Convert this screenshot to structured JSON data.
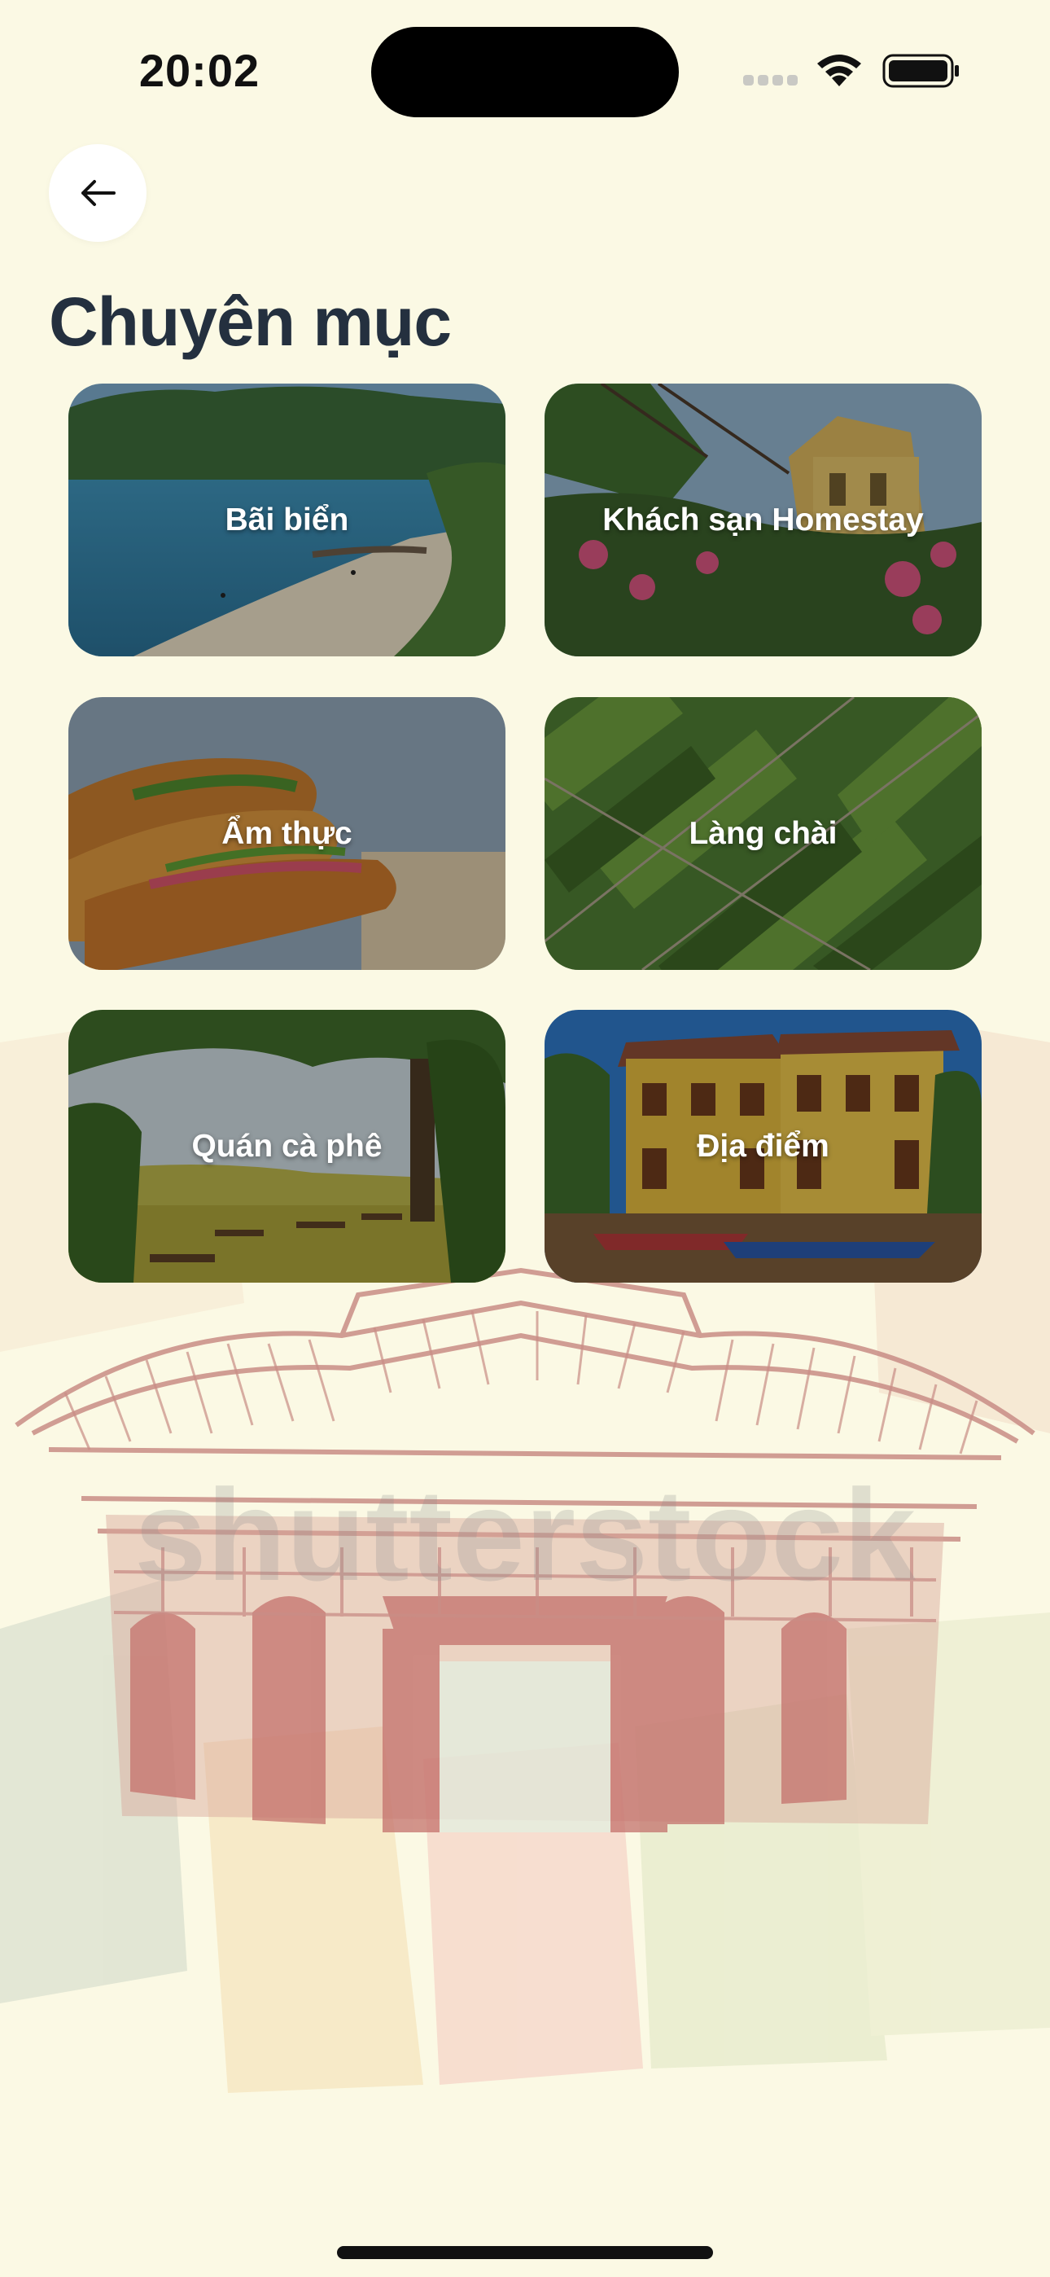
{
  "status_bar": {
    "time": "20:02",
    "icons": [
      "cellular-signal-icon",
      "wifi-icon",
      "battery-icon"
    ]
  },
  "header": {
    "back_icon": "arrow-left-icon",
    "title": "Chuyên mục"
  },
  "categories": [
    {
      "label": "Bãi biển",
      "image": "beach-photo"
    },
    {
      "label": "Khách sạn Homestay",
      "image": "homestay-photo"
    },
    {
      "label": "Ẩm thực",
      "image": "banh-mi-photo"
    },
    {
      "label": "Làng chài",
      "image": "fishing-village-aerial-photo"
    },
    {
      "label": "Quán cà phê",
      "image": "cafe-garden-photo"
    },
    {
      "label": "Địa điểm",
      "image": "hoi-an-old-town-photo"
    }
  ],
  "background": {
    "illustration": "japanese-covered-bridge-sketch",
    "watermark": "shutterstock"
  },
  "colors": {
    "page_background": "#fbf9e4",
    "title": "#24303f",
    "card_label": "#ffffff",
    "sketch": "#c98d86"
  }
}
